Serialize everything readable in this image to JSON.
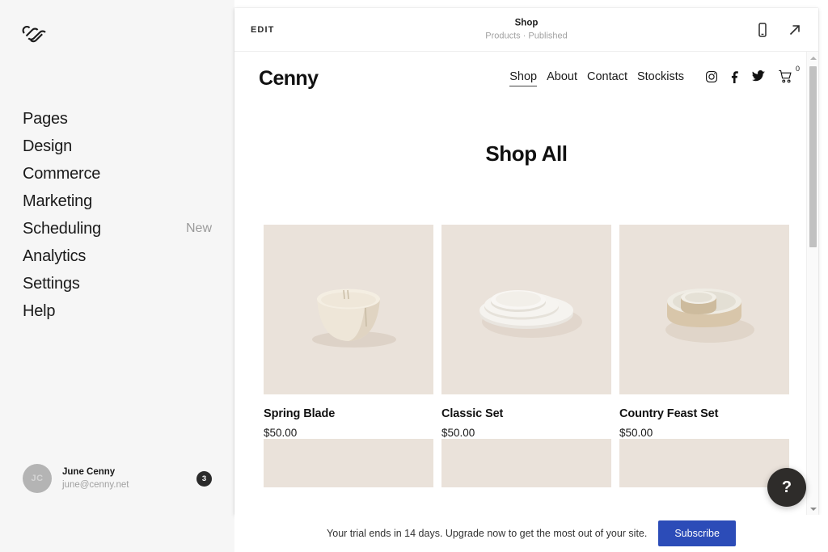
{
  "sidebar": {
    "logo_icon": "squarespace-logo",
    "items": [
      {
        "label": "Pages",
        "badge": ""
      },
      {
        "label": "Design",
        "badge": ""
      },
      {
        "label": "Commerce",
        "badge": ""
      },
      {
        "label": "Marketing",
        "badge": ""
      },
      {
        "label": "Scheduling",
        "badge": "New"
      },
      {
        "label": "Analytics",
        "badge": ""
      },
      {
        "label": "Settings",
        "badge": ""
      },
      {
        "label": "Help",
        "badge": ""
      }
    ],
    "user": {
      "initials": "JC",
      "name": "June Cenny",
      "email": "june@cenny.net",
      "notification_count": "3"
    }
  },
  "preview_topbar": {
    "edit_label": "EDIT",
    "title": "Shop",
    "subtitle": "Products · Published",
    "mobile_icon": "mobile-device-icon",
    "open_icon": "open-external-icon"
  },
  "site": {
    "logo": "Cenny",
    "nav": [
      {
        "label": "Shop",
        "active": true
      },
      {
        "label": "About",
        "active": false
      },
      {
        "label": "Contact",
        "active": false
      },
      {
        "label": "Stockists",
        "active": false
      }
    ],
    "social": [
      "instagram-icon",
      "facebook-icon",
      "twitter-icon"
    ],
    "cart": {
      "icon": "shopping-cart-icon",
      "count": "0"
    },
    "page_title": "Shop All",
    "products": [
      {
        "name": "Spring Blade",
        "price": "$50.00",
        "image": "ceramic-bowl"
      },
      {
        "name": "Classic Set",
        "price": "$50.00",
        "image": "stacked-plates"
      },
      {
        "name": "Country Feast Set",
        "price": "$50.00",
        "image": "nested-bowls"
      }
    ],
    "product_tile_bg": "#eae2da"
  },
  "help": {
    "label": "?"
  },
  "trial": {
    "message": "Your trial ends in 14 days. Upgrade now to get the most out of your site.",
    "button_label": "Subscribe",
    "button_color": "#2c4cb8"
  }
}
